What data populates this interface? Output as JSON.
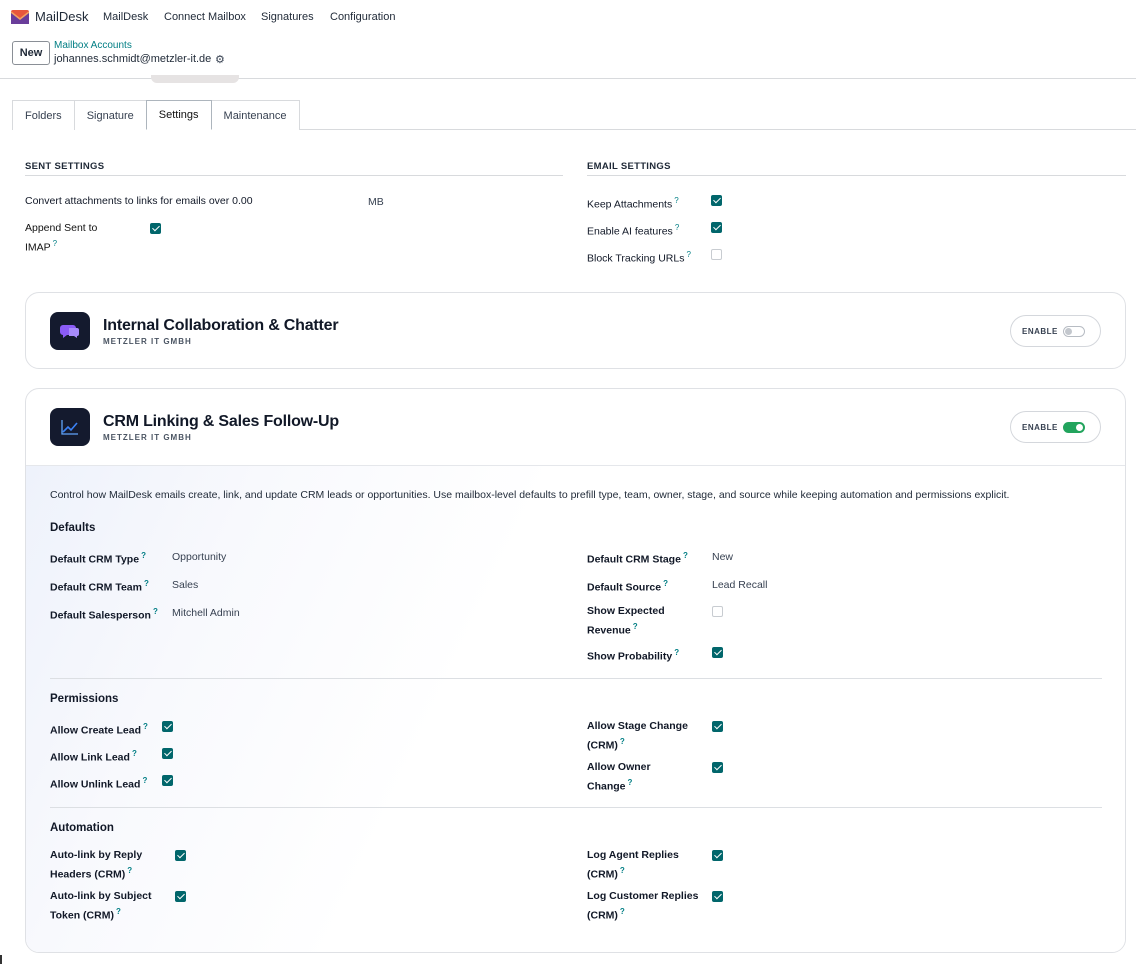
{
  "app": {
    "brand": "MailDesk"
  },
  "nav": {
    "items": [
      "MailDesk",
      "Connect Mailbox",
      "Signatures",
      "Configuration"
    ]
  },
  "control": {
    "new_label": "New",
    "breadcrumb_parent": "Mailbox Accounts",
    "breadcrumb_current": "johannes.schmidt@metzler-it.de",
    "gear_icon": "gear-icon"
  },
  "tabs": [
    {
      "label": "Folders",
      "active": false
    },
    {
      "label": "Signature",
      "active": false
    },
    {
      "label": "Settings",
      "active": true
    },
    {
      "label": "Maintenance",
      "active": false
    }
  ],
  "sent_settings": {
    "title": "SENT SETTINGS",
    "convert_label": "Convert attachments to links for emails over",
    "convert_value": "0.00",
    "convert_unit": "MB",
    "append_label_1": "Append Sent to",
    "append_label_2": "IMAP",
    "append_checked": true
  },
  "email_settings": {
    "title": "EMAIL SETTINGS",
    "keep_label": "Keep Attachments",
    "keep_checked": true,
    "ai_label": "Enable AI features",
    "ai_checked": true,
    "block_label": "Block Tracking URLs",
    "block_checked": false
  },
  "help_mark": "?",
  "cards": {
    "collab": {
      "title": "Internal Collaboration & Chatter",
      "subtitle": "METZLER IT GMBH",
      "enable_label": "ENABLE",
      "enabled": false,
      "icon": "chat-bubbles-icon"
    },
    "crm": {
      "title": "CRM Linking & Sales Follow-Up",
      "subtitle": "METZLER IT GMBH",
      "enable_label": "ENABLE",
      "enabled": true,
      "icon": "trend-chart-icon",
      "description": "Control how MailDesk emails create, link, and update CRM leads or opportunities. Use mailbox-level defaults to prefill type, team, owner, stage, and source while keeping automation and permissions explicit.",
      "defaults": {
        "title": "Defaults",
        "type_label": "Default CRM Type",
        "type_value": "Opportunity",
        "team_label": "Default CRM Team",
        "team_value": "Sales",
        "sales_label": "Default Salesperson",
        "sales_value": "Mitchell Admin",
        "stage_label": "Default CRM Stage",
        "stage_value": "New",
        "source_label": "Default Source",
        "source_value": "Lead Recall",
        "revenue_label_1": "Show Expected",
        "revenue_label_2": "Revenue",
        "revenue_checked": false,
        "prob_label": "Show Probability",
        "prob_checked": true
      },
      "permissions": {
        "title": "Permissions",
        "create_label": "Allow Create Lead",
        "create_checked": true,
        "link_label": "Allow Link Lead",
        "link_checked": true,
        "unlink_label": "Allow Unlink Lead",
        "unlink_checked": true,
        "stage_label_1": "Allow Stage Change",
        "stage_label_2": "(CRM)",
        "stage_checked": true,
        "owner_label_1": "Allow Owner",
        "owner_label_2": "Change",
        "owner_checked": true
      },
      "automation": {
        "title": "Automation",
        "reply_label_1": "Auto-link by Reply",
        "reply_label_2": "Headers (CRM)",
        "reply_checked": true,
        "subject_label_1": "Auto-link by Subject",
        "subject_label_2": "Token (CRM)",
        "subject_checked": true,
        "agent_label_1": "Log Agent Replies",
        "agent_label_2": "(CRM)",
        "agent_checked": true,
        "customer_label_1": "Log Customer Replies",
        "customer_label_2": "(CRM)",
        "customer_checked": true
      }
    }
  },
  "colors": {
    "accent": "#017e84",
    "checkbox": "#01666b",
    "toggle_on": "#22a45d",
    "app_icon_bg": "#141a2e"
  }
}
